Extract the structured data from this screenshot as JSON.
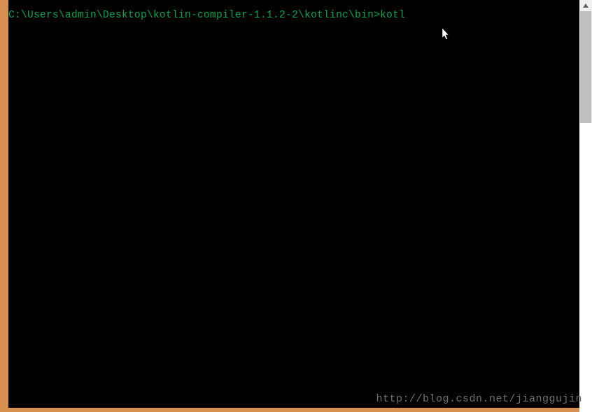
{
  "terminal": {
    "prompt_path": "C:\\Users\\admin\\Desktop\\kotlin-compiler-1.1.2-2\\kotlinc\\bin>",
    "typed_command": "kotl"
  },
  "watermark_text": "http://blog.csdn.net/jianggujin"
}
